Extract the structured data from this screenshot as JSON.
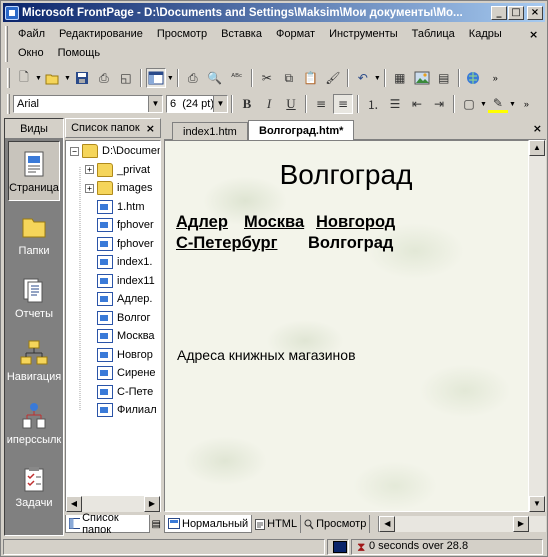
{
  "window": {
    "title": "Microsoft FrontPage - D:\\Documents and Settings\\Maksim\\Мои документы\\Мо..."
  },
  "menu": {
    "row1": [
      "Файл",
      "Редактирование",
      "Просмотр",
      "Вставка",
      "Формат",
      "Инструменты",
      "Таблица",
      "Кадры"
    ],
    "row2": [
      "Окно",
      "Помощь"
    ]
  },
  "format_toolbar": {
    "font": "Arial",
    "size": "6  (24 pt)"
  },
  "views": {
    "header": "Виды",
    "items": [
      {
        "label": "Страница",
        "icon": "page-view-icon"
      },
      {
        "label": "Папки",
        "icon": "folders-view-icon"
      },
      {
        "label": "Отчеты",
        "icon": "reports-view-icon"
      },
      {
        "label": "Навигация",
        "icon": "navigation-view-icon"
      },
      {
        "label": "иперссылк",
        "icon": "hyperlinks-view-icon"
      },
      {
        "label": "Задачи",
        "icon": "tasks-view-icon"
      }
    ]
  },
  "folder_list": {
    "header": "Список папок",
    "items": [
      {
        "label": "D:\\Documen",
        "type": "folder",
        "level": 0,
        "expander": "−"
      },
      {
        "label": "_privat",
        "type": "folder",
        "level": 1,
        "expander": "+"
      },
      {
        "label": "images",
        "type": "folder",
        "level": 1,
        "expander": "+"
      },
      {
        "label": "1.htm",
        "type": "page",
        "level": 1
      },
      {
        "label": "fphover",
        "type": "page",
        "level": 1
      },
      {
        "label": "fphover",
        "type": "page",
        "level": 1
      },
      {
        "label": "index1.",
        "type": "page",
        "level": 1
      },
      {
        "label": "index11",
        "type": "page",
        "level": 1
      },
      {
        "label": "Адлер.",
        "type": "page",
        "level": 1
      },
      {
        "label": "Волгог",
        "type": "page",
        "level": 1
      },
      {
        "label": "Москва",
        "type": "page",
        "level": 1
      },
      {
        "label": "Новгор",
        "type": "page",
        "level": 1
      },
      {
        "label": "Сирене",
        "type": "page",
        "level": 1
      },
      {
        "label": "С-Пете",
        "type": "page",
        "level": 1
      },
      {
        "label": "Филиал",
        "type": "page",
        "level": 1
      }
    ],
    "tab": "Список папок"
  },
  "editor": {
    "tabs": [
      "index1.htm",
      "Волгоград.htm*"
    ],
    "doc_title": "Волгоград",
    "links_row1": [
      "Адлер",
      "Москва",
      "Новгород"
    ],
    "links_row2": [
      "С-Петербург"
    ],
    "current_city": "Волгоград",
    "text": "Адреса книжных магазинов",
    "view_tabs": [
      "Нормальный",
      "HTML",
      "Просмотр"
    ]
  },
  "status": {
    "text": "0 seconds over 28.8"
  }
}
